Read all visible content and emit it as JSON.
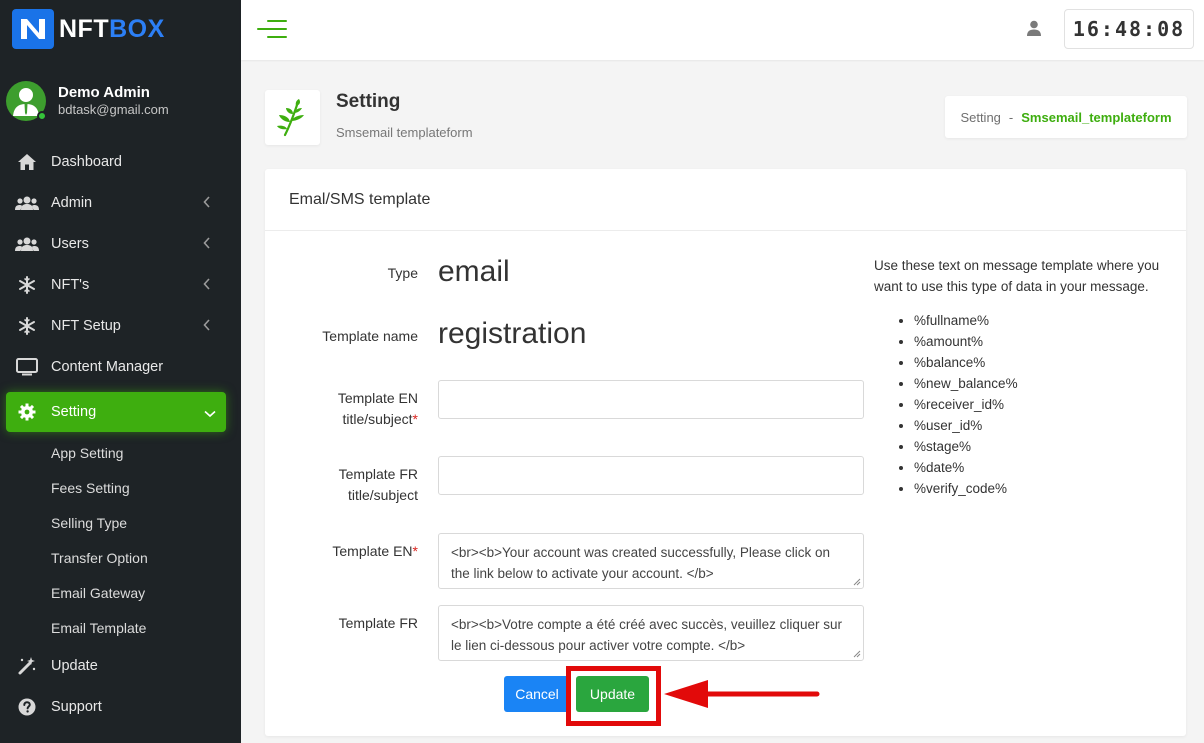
{
  "brand": {
    "name_part1": "NFT",
    "name_part2": "BOX"
  },
  "user": {
    "name": "Demo Admin",
    "email": "bdtask@gmail.com"
  },
  "sidebar": {
    "items": [
      {
        "label": "Dashboard",
        "icon": "home-icon"
      },
      {
        "label": "Admin",
        "icon": "users-icon"
      },
      {
        "label": "Users",
        "icon": "users-icon"
      },
      {
        "label": "NFT's",
        "icon": "snowflake-icon"
      },
      {
        "label": "NFT Setup",
        "icon": "snowflake-icon"
      },
      {
        "label": "Content Manager",
        "icon": "monitor-icon"
      },
      {
        "label": "Setting",
        "icon": "gear-icon"
      },
      {
        "label": "Update",
        "icon": "magic-wand-icon"
      },
      {
        "label": "Support",
        "icon": "question-circle-icon"
      }
    ],
    "setting_submenu": [
      "App Setting",
      "Fees Setting",
      "Selling Type",
      "Transfer Option",
      "Email Gateway",
      "Email Template"
    ]
  },
  "topbar": {
    "clock": "16:48:08"
  },
  "page": {
    "title": "Setting",
    "subtitle": "Smsemail templateform",
    "breadcrumb": {
      "root": "Setting",
      "separator": "-",
      "current": "Smsemail_templateform"
    }
  },
  "form": {
    "card_title": "Emal/SMS template",
    "type_label": "Type",
    "type_value": "email",
    "template_name_label": "Template name",
    "template_name_value": "registration",
    "title_en_label_line1": "Template EN",
    "title_en_label_line2": "title/subject",
    "title_en_value": "",
    "title_fr_label_line1": "Template FR",
    "title_fr_label_line2": "title/subject",
    "title_fr_value": "",
    "template_en_label": "Template EN",
    "template_en_value": "<br><b>Your account was created successfully, Please click on the link below to activate your account. </b>",
    "template_fr_label": "Template FR",
    "template_fr_value": "<br><b>Votre compte a été créé avec succès, veuillez cliquer sur le lien ci-dessous pour activer votre compte. </b>",
    "required_mark": "*",
    "cancel_label": "Cancel",
    "update_label": "Update"
  },
  "help": {
    "intro": "Use these text on message template where you want to use this type of data in your message.",
    "variables": [
      "%fullname%",
      "%amount%",
      "%balance%",
      "%new_balance%",
      "%receiver_id%",
      "%user_id%",
      "%stage%",
      "%date%",
      "%verify_code%"
    ]
  },
  "colors": {
    "accent": "#3eae0f",
    "sidebar_bg": "#1e2326",
    "primary_blue": "#1a84f5",
    "update_green": "#2aa63e",
    "annotation_red": "#e20a0a"
  }
}
